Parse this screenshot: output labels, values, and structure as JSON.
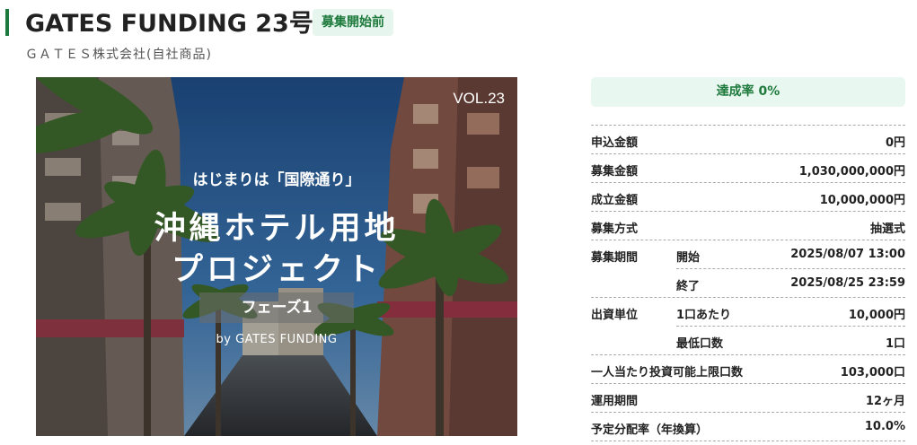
{
  "header": {
    "title": "GATES FUNDING 23号",
    "status_badge": "募集開始前",
    "company": "ＧＡＴＥＳ株式会社(自社商品)"
  },
  "hero": {
    "vol": "VOL.23",
    "subtitle": "はじまりは「国際通り」",
    "main_line1": "沖縄ホテル用地",
    "main_line2": "プロジェクト",
    "phase": "フェーズ1",
    "byline": "by GATES FUNDING"
  },
  "progress": {
    "label": "達成率 0%"
  },
  "details": {
    "applied_amount": {
      "label": "申込金額",
      "value": "0円"
    },
    "target_amount": {
      "label": "募集金額",
      "value": "1,030,000,000円"
    },
    "min_amount": {
      "label": "成立金額",
      "value": "10,000,000円"
    },
    "method": {
      "label": "募集方式",
      "value": "抽選式"
    },
    "period": {
      "label": "募集期間",
      "start_label": "開始",
      "start_value": "2025/08/07 13:00",
      "end_label": "終了",
      "end_value": "2025/08/25 23:59"
    },
    "unit": {
      "label": "出資単位",
      "per_unit_label": "1口あたり",
      "per_unit_value": "10,000円",
      "min_units_label": "最低口数",
      "min_units_value": "1口"
    },
    "max_units": {
      "label": "一人当たり投資可能上限口数",
      "value": "103,000口"
    },
    "term": {
      "label": "運用期間",
      "value": "12ヶ月"
    },
    "yield": {
      "label": "予定分配率（年換算）",
      "value": "10.0%"
    }
  },
  "colors": {
    "accent": "#1e7a3c",
    "badge_bg": "#e6f6ee",
    "progress_bg": "#e9f7f1"
  }
}
